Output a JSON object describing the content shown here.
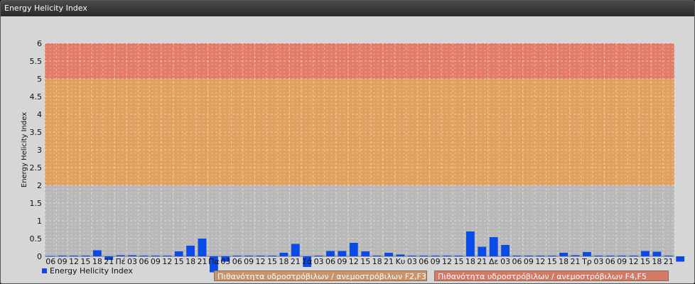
{
  "window": {
    "title": "Energy Helicity Index"
  },
  "colors": {
    "bar": "#0a4ae6",
    "band_low": "#b8b8b8",
    "band_mid": "#e0a05e",
    "band_high": "#e27b67",
    "label_mid": "#c8946b",
    "label_high": "#d27a66"
  },
  "chart_data": {
    "type": "bar",
    "ylabel": "Energy Helicity Index",
    "ylim": [
      -0.5,
      6
    ],
    "yticks": [
      "0",
      "0.5",
      "1",
      "1.5",
      "2",
      "2.5",
      "3",
      "3.5",
      "4",
      "4.5",
      "5",
      "5.5",
      "6"
    ],
    "grid": true,
    "legend": "bottom-left",
    "categories": [
      "06",
      "09",
      "12",
      "15",
      "18",
      "21",
      "Πέ",
      "03",
      "06",
      "09",
      "12",
      "15",
      "18",
      "21",
      "Πα",
      "03",
      "06",
      "09",
      "12",
      "15",
      "18",
      "21",
      "Σά",
      "03",
      "06",
      "09",
      "12",
      "15",
      "18",
      "21",
      "Κυ",
      "03",
      "06",
      "09",
      "12",
      "15",
      "18",
      "21",
      "Δε",
      "03",
      "06",
      "09",
      "12",
      "15",
      "18",
      "21",
      "Τρ",
      "03",
      "06",
      "09",
      "12",
      "15",
      "18",
      "21"
    ],
    "series": [
      {
        "name": "Energy Helicity Index",
        "values": [
          0.01,
          0.02,
          0.02,
          0.02,
          0.17,
          -0.1,
          0.03,
          0.03,
          0.02,
          0.02,
          0.02,
          0.14,
          0.3,
          0.5,
          -0.45,
          -0.15,
          0.02,
          0.02,
          0.02,
          0.02,
          0.1,
          0.35,
          -0.3,
          0.02,
          0.15,
          0.15,
          0.38,
          0.14,
          0.02,
          0.1,
          0.05,
          0.02,
          0.02,
          0.02,
          0.02,
          0.02,
          0.7,
          0.27,
          0.54,
          0.32,
          0.02,
          0.02,
          0.02,
          0.02,
          0.1,
          0.03,
          0.12,
          0.02,
          0.02,
          0.02,
          0.02,
          0.15,
          0.13,
          0.02,
          -0.15
        ]
      }
    ],
    "bands": [
      {
        "from": 0,
        "to": 2,
        "label": ""
      },
      {
        "from": 2,
        "to": 5,
        "label": "Πιθανότητα υδροστρόβιλων / ανεμοστρόβιλων F2,F3"
      },
      {
        "from": 5,
        "to": 6,
        "label": "Πιθανότητα υδροστρόβιλων / ανεμοστρόβιλων F4,F5"
      }
    ]
  }
}
